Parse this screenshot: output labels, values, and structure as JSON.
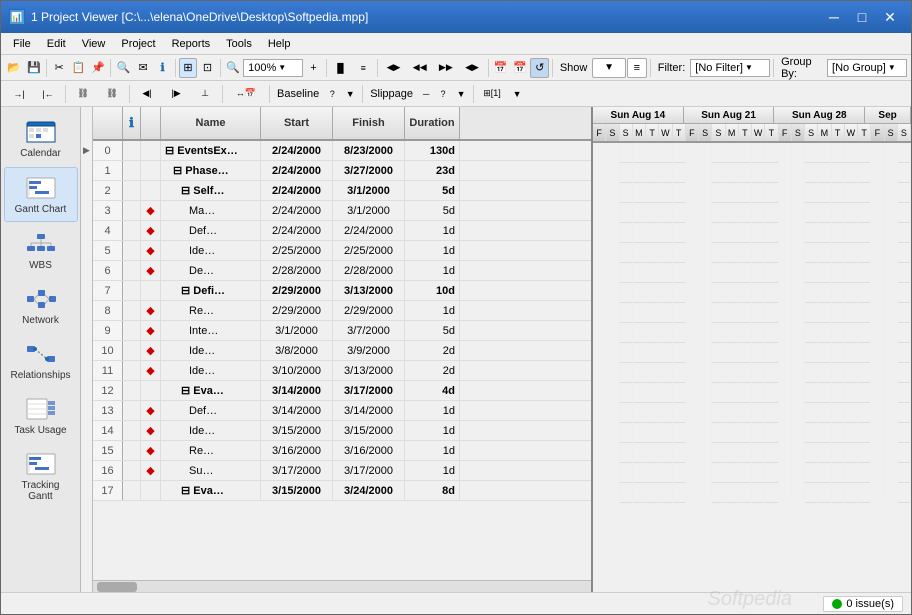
{
  "window": {
    "title": "1 Project Viewer [C:\\...\\elena\\OneDrive\\Desktop\\Softpedia.mpp]",
    "icon": "📊"
  },
  "titleButtons": {
    "minimize": "─",
    "maximize": "□",
    "close": "✕"
  },
  "menu": {
    "items": [
      "File",
      "Edit",
      "View",
      "Project",
      "Reports",
      "Tools",
      "Help"
    ]
  },
  "toolbar1": {
    "zoom": "100%",
    "filter_label": "Filter:",
    "filter_value": "[No Filter]",
    "groupby_label": "Group By:",
    "groupby_value": "[No Group]"
  },
  "toolbar2": {
    "show_label": "Show",
    "baseline_label": "Baseline",
    "slippage_label": "Slippage"
  },
  "sidebar": {
    "items": [
      {
        "id": "calendar",
        "label": "Calendar"
      },
      {
        "id": "gantt",
        "label": "Gantt Chart"
      },
      {
        "id": "wbs",
        "label": "WBS"
      },
      {
        "id": "network",
        "label": "Network"
      },
      {
        "id": "relationships",
        "label": "Relationships"
      },
      {
        "id": "taskusage",
        "label": "Task Usage"
      },
      {
        "id": "trackinggant",
        "label": "Tracking\nGantt"
      }
    ]
  },
  "table": {
    "headers": {
      "id": "",
      "info": "ℹ",
      "indicator": "",
      "name": "Name",
      "start": "Start",
      "finish": "Finish",
      "duration": "Duration"
    },
    "rows": [
      {
        "id": "0",
        "indicator": "",
        "name": "⊟ EventsEx…",
        "start": "2/24/2000",
        "finish": "8/23/2000",
        "duration": "130d",
        "bold": true,
        "level": 0
      },
      {
        "id": "1",
        "indicator": "",
        "name": "⊟ Phase…",
        "start": "2/24/2000",
        "finish": "3/27/2000",
        "duration": "23d",
        "bold": true,
        "level": 1
      },
      {
        "id": "2",
        "indicator": "",
        "name": "⊟ Self…",
        "start": "2/24/2000",
        "finish": "3/1/2000",
        "duration": "5d",
        "bold": true,
        "level": 2
      },
      {
        "id": "3",
        "indicator": "◆",
        "name": "Ma…",
        "start": "2/24/2000",
        "finish": "3/1/2000",
        "duration": "5d",
        "bold": false,
        "level": 3
      },
      {
        "id": "4",
        "indicator": "◆",
        "name": "Def…",
        "start": "2/24/2000",
        "finish": "2/24/2000",
        "duration": "1d",
        "bold": false,
        "level": 3
      },
      {
        "id": "5",
        "indicator": "◆",
        "name": "Ide…",
        "start": "2/25/2000",
        "finish": "2/25/2000",
        "duration": "1d",
        "bold": false,
        "level": 3
      },
      {
        "id": "6",
        "indicator": "◆",
        "name": "De…",
        "start": "2/28/2000",
        "finish": "2/28/2000",
        "duration": "1d",
        "bold": false,
        "level": 3
      },
      {
        "id": "7",
        "indicator": "",
        "name": "⊟ Defi…",
        "start": "2/29/2000",
        "finish": "3/13/2000",
        "duration": "10d",
        "bold": true,
        "level": 2
      },
      {
        "id": "8",
        "indicator": "◆",
        "name": "Re…",
        "start": "2/29/2000",
        "finish": "2/29/2000",
        "duration": "1d",
        "bold": false,
        "level": 3
      },
      {
        "id": "9",
        "indicator": "◆",
        "name": "Inte…",
        "start": "3/1/2000",
        "finish": "3/7/2000",
        "duration": "5d",
        "bold": false,
        "level": 3
      },
      {
        "id": "10",
        "indicator": "◆",
        "name": "Ide…",
        "start": "3/8/2000",
        "finish": "3/9/2000",
        "duration": "2d",
        "bold": false,
        "level": 3
      },
      {
        "id": "11",
        "indicator": "◆",
        "name": "Ide…",
        "start": "3/10/2000",
        "finish": "3/13/2000",
        "duration": "2d",
        "bold": false,
        "level": 3
      },
      {
        "id": "12",
        "indicator": "",
        "name": "⊟ Eva…",
        "start": "3/14/2000",
        "finish": "3/17/2000",
        "duration": "4d",
        "bold": true,
        "level": 2
      },
      {
        "id": "13",
        "indicator": "◆",
        "name": "Def…",
        "start": "3/14/2000",
        "finish": "3/14/2000",
        "duration": "1d",
        "bold": false,
        "level": 3
      },
      {
        "id": "14",
        "indicator": "◆",
        "name": "Ide…",
        "start": "3/15/2000",
        "finish": "3/15/2000",
        "duration": "1d",
        "bold": false,
        "level": 3
      },
      {
        "id": "15",
        "indicator": "◆",
        "name": "Re…",
        "start": "3/16/2000",
        "finish": "3/16/2000",
        "duration": "1d",
        "bold": false,
        "level": 3
      },
      {
        "id": "16",
        "indicator": "◆",
        "name": "Su…",
        "start": "3/17/2000",
        "finish": "3/17/2000",
        "duration": "1d",
        "bold": false,
        "level": 3
      },
      {
        "id": "17",
        "indicator": "",
        "name": "⊟ Eva…",
        "start": "3/15/2000",
        "finish": "3/24/2000",
        "duration": "8d",
        "bold": true,
        "level": 2
      }
    ]
  },
  "gantt": {
    "weeks": [
      {
        "label": "Sun Aug 14"
      },
      {
        "label": "Sun Aug 21"
      },
      {
        "label": "Sun Aug 28"
      },
      {
        "label": "Sep"
      }
    ],
    "days": [
      "F",
      "S",
      "S",
      "M",
      "T",
      "W",
      "T",
      "F",
      "S",
      "S",
      "M",
      "T",
      "W",
      "T",
      "F",
      "S",
      "S",
      "M",
      "T",
      "W",
      "T",
      "F",
      "S",
      "S"
    ]
  },
  "statusBar": {
    "issues": "0 issue(s)"
  },
  "colors": {
    "accent": "#1a6bb5",
    "ganttBar": "#4472c4",
    "milestone": "#cc0000",
    "summaryBar": "#4472c4",
    "weekend": "#f0f0f0"
  }
}
